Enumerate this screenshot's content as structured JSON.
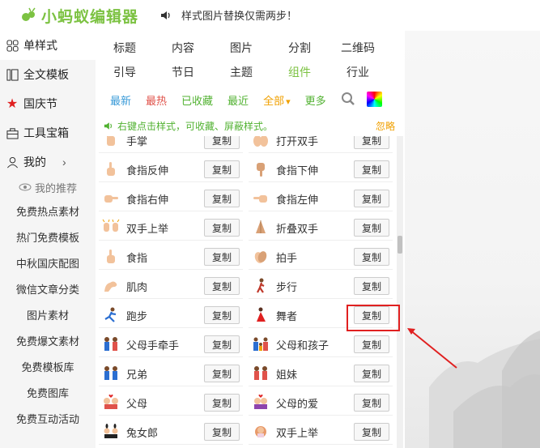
{
  "app": {
    "title": "小蚂蚁编辑器"
  },
  "notice": {
    "text": "样式图片替换仅需两步！"
  },
  "sidebar": {
    "main_items": [
      {
        "label": "单样式",
        "icon": "grid-icon",
        "active": true
      },
      {
        "label": "全文模板",
        "icon": "layout-icon"
      },
      {
        "label": "国庆节",
        "icon": "star-icon"
      },
      {
        "label": "工具宝箱",
        "icon": "toolbox-icon"
      },
      {
        "label": "我的",
        "icon": "user-icon",
        "chevron": "›"
      }
    ],
    "recommend_label": "我的推荐",
    "sub_items": [
      "免费热点素材",
      "热门免费模板",
      "中秋国庆配图",
      "微信文章分类",
      "图片素材",
      "免费爆文素材",
      "免费模板库",
      "免费图库",
      "免费互动活动"
    ]
  },
  "tabs_row1": [
    "标题",
    "内容",
    "图片",
    "分割",
    "二维码"
  ],
  "tabs_row2": [
    "引导",
    "节日",
    "主题",
    "组件",
    "行业"
  ],
  "selected_tab": "组件",
  "filters": [
    {
      "label": "最新",
      "color": "#3a9bd8"
    },
    {
      "label": "最热",
      "color": "#e0524a"
    },
    {
      "label": "已收藏",
      "color": "#52b232"
    },
    {
      "label": "最近",
      "color": "#52b232"
    },
    {
      "label": "全部",
      "color": "#f0a000",
      "dropdown": "▾"
    },
    {
      "label": "更多",
      "color": "#52b232"
    }
  ],
  "tip": {
    "text": "右键点击样式，可收藏、屏蔽样式。",
    "ignore": "忽略"
  },
  "copy_label": "复制",
  "items": [
    [
      {
        "name": "手掌",
        "icon": "hand-palm-icon"
      },
      {
        "name": "打开双手",
        "icon": "open-hands-icon"
      }
    ],
    [
      {
        "name": "食指反伸",
        "icon": "finger-up-icon"
      },
      {
        "name": "食指下伸",
        "icon": "finger-down-icon"
      }
    ],
    [
      {
        "name": "食指右伸",
        "icon": "finger-right-icon"
      },
      {
        "name": "食指左伸",
        "icon": "finger-left-icon"
      }
    ],
    [
      {
        "name": "双手上举",
        "icon": "raised-hands-icon"
      },
      {
        "name": "折叠双手",
        "icon": "folded-hands-icon"
      }
    ],
    [
      {
        "name": "食指",
        "icon": "index-finger-icon"
      },
      {
        "name": "拍手",
        "icon": "clap-icon"
      }
    ],
    [
      {
        "name": "肌肉",
        "icon": "muscle-icon"
      },
      {
        "name": "步行",
        "icon": "walking-icon"
      }
    ],
    [
      {
        "name": "跑步",
        "icon": "running-icon"
      },
      {
        "name": "舞者",
        "icon": "dancer-icon"
      }
    ],
    [
      {
        "name": "父母手牵手",
        "icon": "couple-icon"
      },
      {
        "name": "父母和孩子",
        "icon": "family-icon"
      }
    ],
    [
      {
        "name": "兄弟",
        "icon": "two-men-icon"
      },
      {
        "name": "姐妹",
        "icon": "two-women-icon"
      }
    ],
    [
      {
        "name": "父母",
        "icon": "couple-heart-icon"
      },
      {
        "name": "父母的爱",
        "icon": "couple-kiss-icon"
      }
    ],
    [
      {
        "name": "兔女郎",
        "icon": "bunny-icon"
      },
      {
        "name": "双手上举",
        "icon": "person-raising-icon"
      }
    ]
  ],
  "colors": {
    "brand": "#7cc242",
    "highlight": "#e02020"
  }
}
